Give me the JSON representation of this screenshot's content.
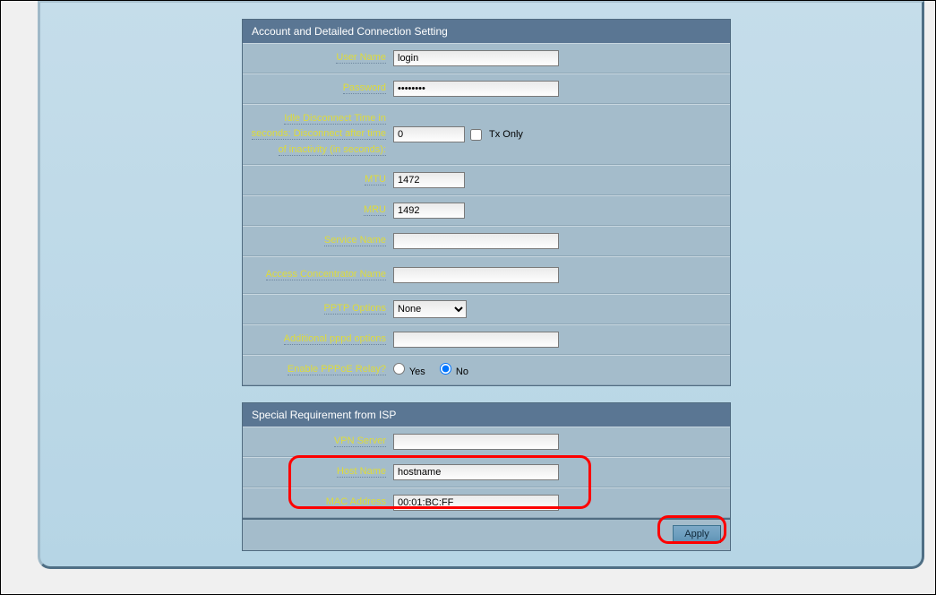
{
  "account": {
    "title": "Account and Detailed Connection Setting",
    "user_name_lbl": "User Name",
    "user_name_val": "login",
    "password_lbl": "Password",
    "password_val": "••••••••",
    "idle_lbl": "Idle Disconnect Time in seconds: Disconnect after time of inactivity (in seconds):",
    "idle_val": "0",
    "tx_only_lbl": "Tx Only",
    "mtu_lbl": "MTU",
    "mtu_val": "1472",
    "mru_lbl": "MRU",
    "mru_val": "1492",
    "service_lbl": "Service Name",
    "service_val": "",
    "ac_lbl": "Access Concentrator Name",
    "ac_val": "",
    "pptp_lbl": "PPTP Options",
    "pptp_val": "None",
    "pppd_lbl": "Additional pppd options",
    "pppd_val": "",
    "relay_lbl": "Enable PPPoE Relay?",
    "relay_yes": "Yes",
    "relay_no": "No"
  },
  "isp": {
    "title": "Special Requirement from ISP",
    "vpn_lbl": "VPN Server",
    "vpn_val": "",
    "host_lbl": "Host Name",
    "host_val": "hostname",
    "mac_lbl": "MAC Address",
    "mac_val": "00:01:BC:FF"
  },
  "buttons": {
    "apply": "Apply"
  }
}
